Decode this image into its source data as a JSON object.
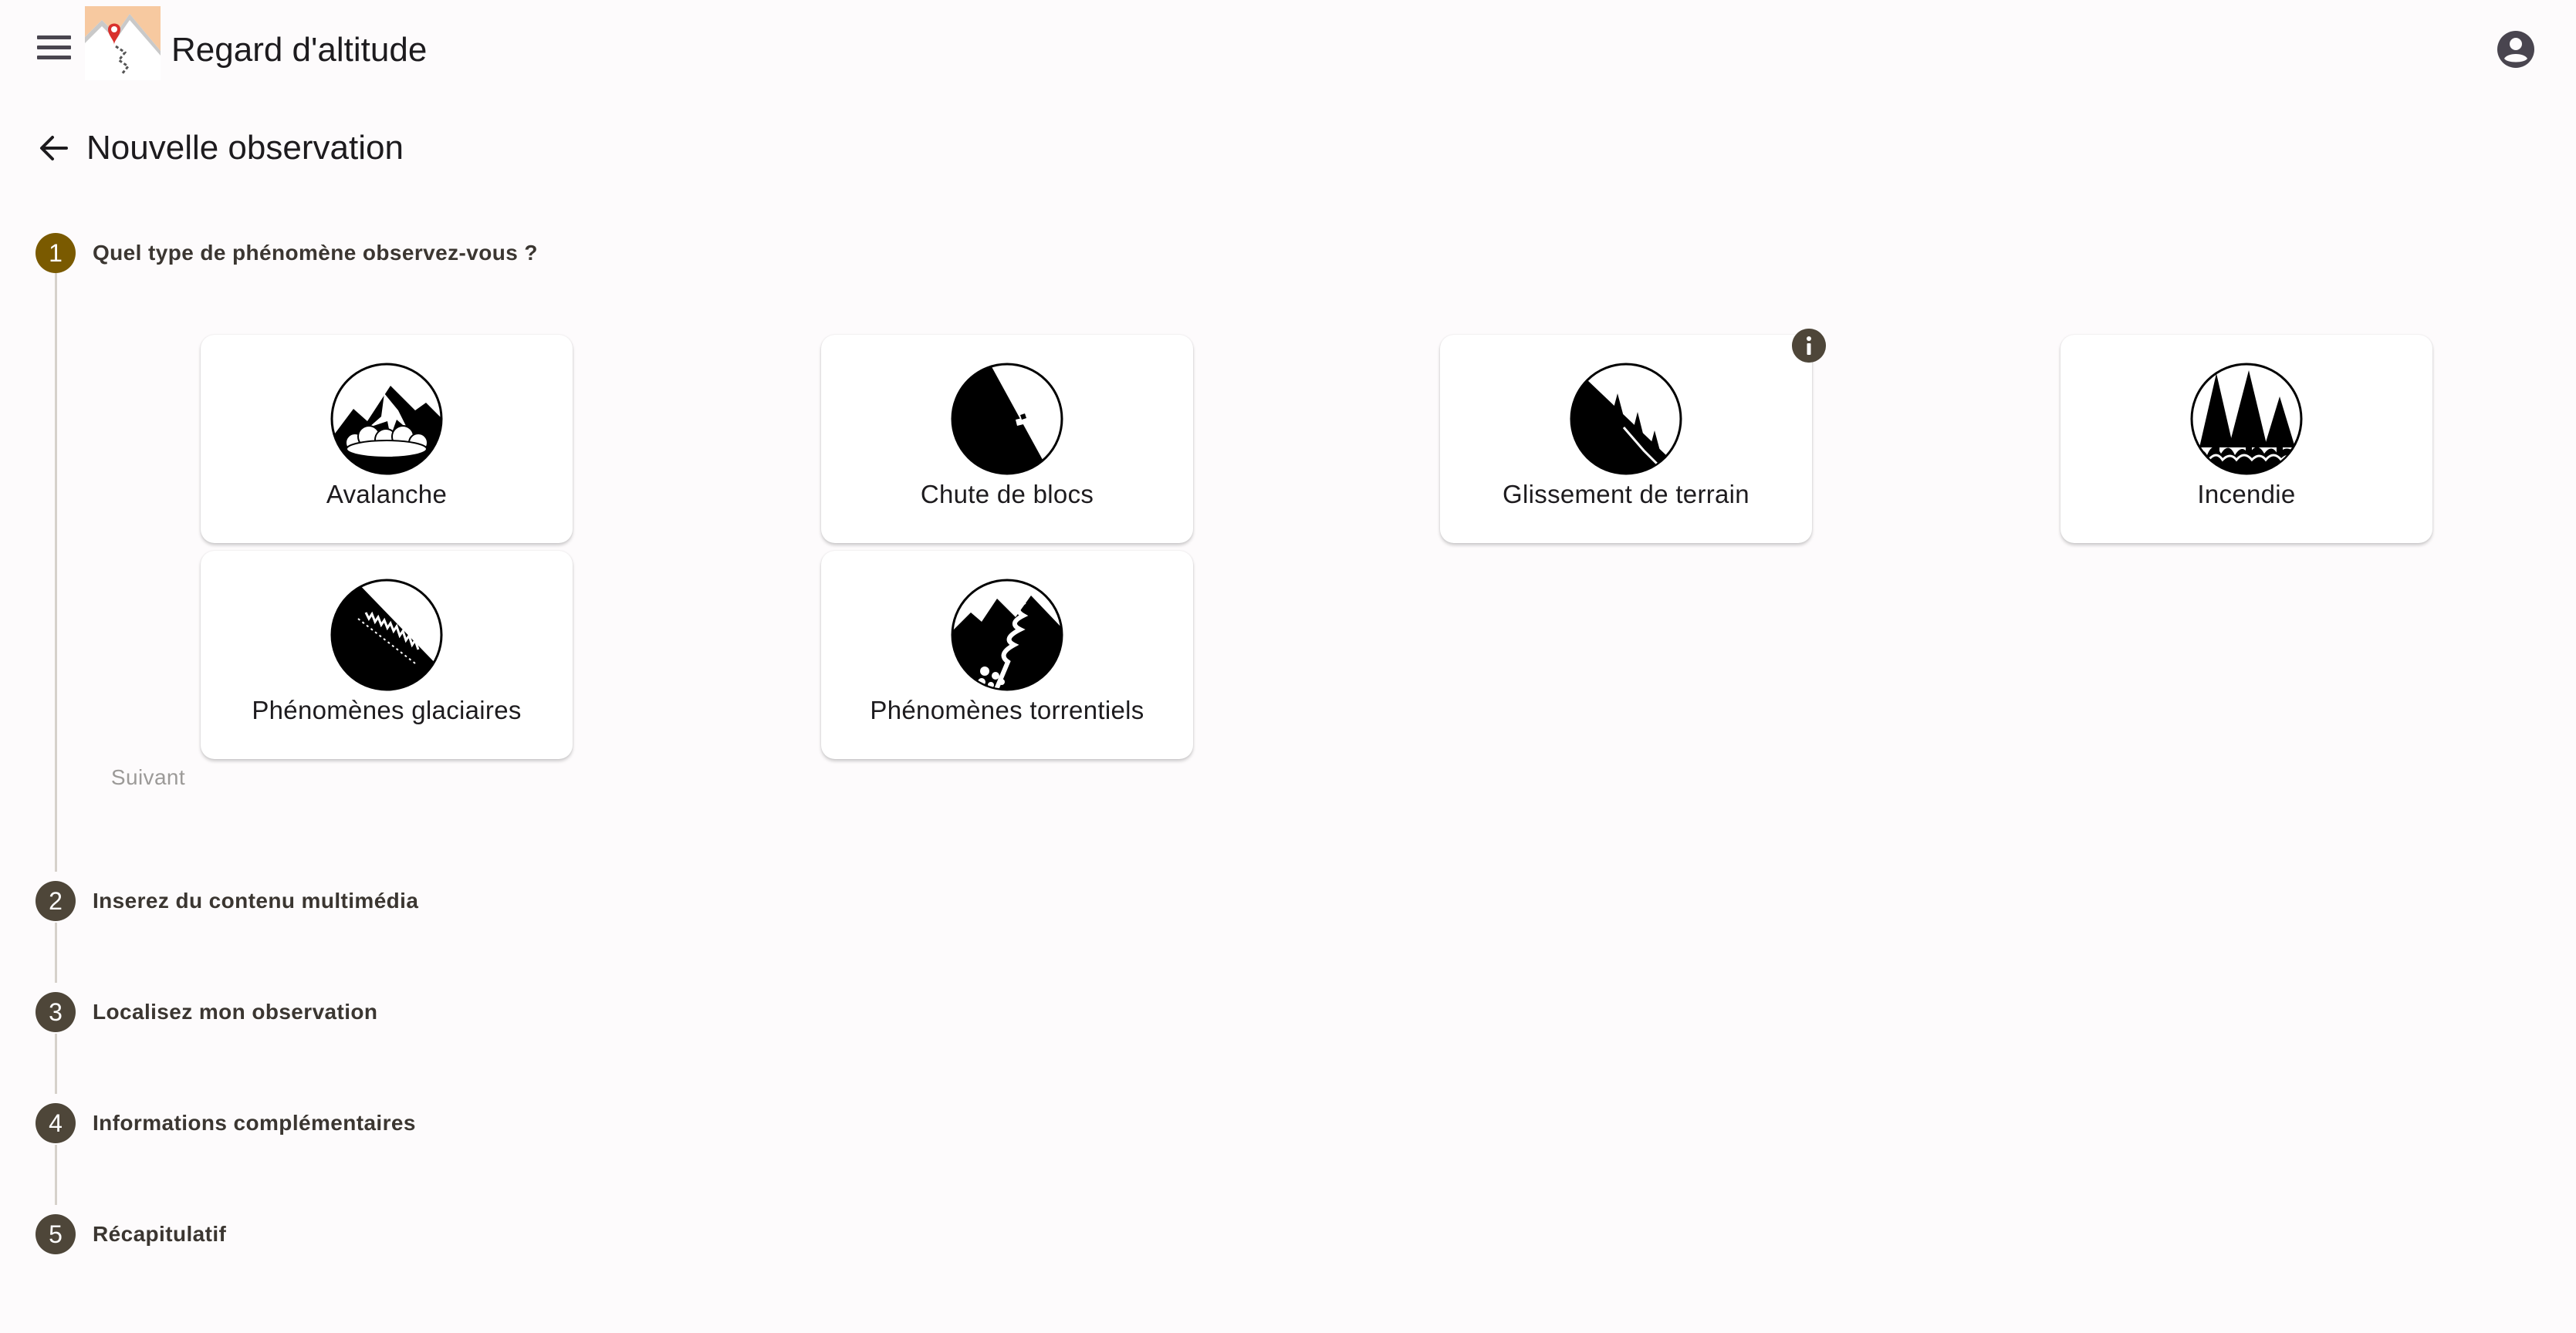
{
  "app": {
    "title": "Regard d'altitude",
    "icons": {
      "menu": "menu-icon",
      "account": "account-circle-icon",
      "logo": "app-logo-icon"
    }
  },
  "page": {
    "title": "Nouvelle observation",
    "back_icon": "arrow-back-icon"
  },
  "stepper": {
    "steps": [
      {
        "number": "1",
        "label": "Quel type de phénomène observez-vous ?",
        "state": "active"
      },
      {
        "number": "2",
        "label": "Inserez du contenu multimédia",
        "state": "pending"
      },
      {
        "number": "3",
        "label": "Localisez mon observation",
        "state": "pending"
      },
      {
        "number": "4",
        "label": "Informations complémentaires",
        "state": "pending"
      },
      {
        "number": "5",
        "label": "Récapitulatif",
        "state": "pending"
      }
    ],
    "next_label": "Suivant"
  },
  "phenomena": [
    {
      "label": "Avalanche",
      "icon": "avalanche-icon"
    },
    {
      "label": "Chute de blocs",
      "icon": "rockfall-icon"
    },
    {
      "label": "Glissement de terrain",
      "icon": "landslide-icon",
      "has_info": true,
      "info_icon": "info-icon"
    },
    {
      "label": "Incendie",
      "icon": "wildfire-icon"
    },
    {
      "label": "Phénomènes glaciaires",
      "icon": "glacier-icon"
    },
    {
      "label": "Phénomènes torrentiels",
      "icon": "torrent-icon"
    }
  ],
  "colors": {
    "active_step": "#7a5a00",
    "pending_step": "#4e4639",
    "background": "#fdfbfc",
    "connector": "#d6d1cb",
    "disabled_text": "#9c9a98"
  }
}
